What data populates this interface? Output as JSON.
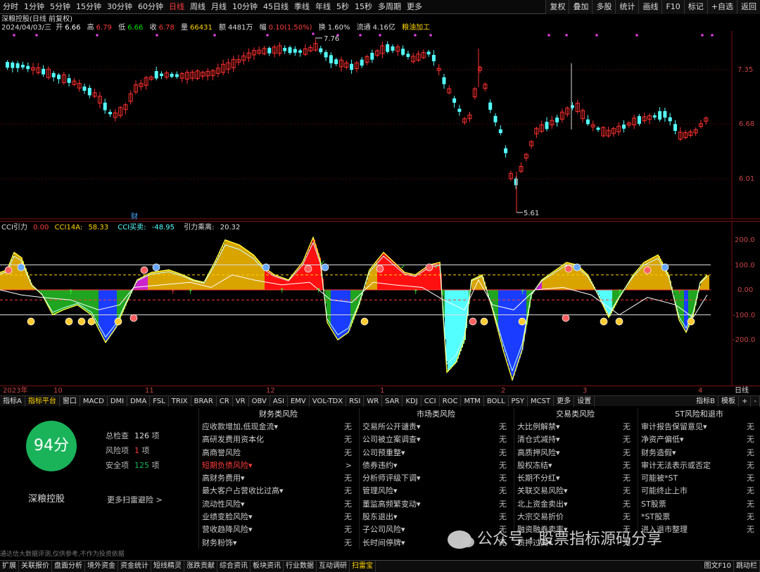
{
  "period_bar": {
    "tabs": [
      "分时",
      "1分钟",
      "5分钟",
      "15分钟",
      "30分钟",
      "60分钟",
      "日线",
      "周线",
      "月线",
      "10分钟",
      "45日线",
      "季线",
      "年线",
      "5秒",
      "15秒",
      "多周期",
      "更多"
    ],
    "active": "日线",
    "right_buttons": [
      "复权",
      "叠加",
      "多股",
      "统计",
      "画线",
      "F10",
      "标记",
      "+自选",
      "返回"
    ]
  },
  "info": {
    "title": "深粮控股(日线 前复权)",
    "date": "2024/04/03/三",
    "open_label": "开",
    "open": "6.66",
    "high_label": "高",
    "high": "6.79",
    "low_label": "低",
    "low": "6.66",
    "close_label": "收",
    "close": "6.78",
    "volume_label": "量",
    "volume": "66431",
    "amount_label": "额",
    "amount": "4481万",
    "change_label": "幅",
    "change": "0.10(1.50%)",
    "turnover_label": "换",
    "turnover": "1.60%",
    "float_label": "流通",
    "float": "4.16亿",
    "industry": "粮油加工",
    "finance_marker": "财"
  },
  "price_chart": {
    "y_labels": [
      "7.35",
      "6.68",
      "6.01"
    ],
    "high_annotation": "7.76",
    "low_annotation": "5.61",
    "colors": {
      "up": "#ff3030",
      "down": "#54ffff",
      "grid": "#7a1010"
    }
  },
  "cci": {
    "name": "CCI引力",
    "v0": "0.00",
    "cci14a_label": "CCI14A:",
    "cci14a": "58.33",
    "cci_deal_label": "CCI买卖:",
    "cci_deal": "-48.95",
    "gravity_label": "引力乘离:",
    "gravity": "20.32",
    "y_labels": [
      "200.0",
      "100.0",
      "0.00",
      "-100.0",
      "-200.0"
    ]
  },
  "time_axis": [
    "2023年",
    "10",
    "11",
    "12",
    "1",
    "2",
    "3",
    "4"
  ],
  "time_axis_right": "日线",
  "indicator_tabs": [
    "指标A",
    "指标平台",
    "窗口",
    "MACD",
    "DMI",
    "DMA",
    "FSL",
    "TRIX",
    "BRAR",
    "CR",
    "VR",
    "OBV",
    "ASI",
    "EMV",
    "VOL-TDX",
    "RSI",
    "WR",
    "SAR",
    "KDJ",
    "CCI",
    "ROC",
    "MTM",
    "BOLL",
    "PSY",
    "MCST",
    "更多",
    "设置"
  ],
  "indicator_active": "指标平台",
  "indicator_right": [
    "指标B",
    "模板",
    "+",
    "-"
  ],
  "scan": {
    "score": "94分",
    "stock_name": "深粮控股",
    "total_label": "总检查",
    "total": "126",
    "total_unit": "项",
    "risk_label": "风险项",
    "risk": "1",
    "risk_unit": "项",
    "safe_label": "安全项",
    "safe": "125",
    "safe_unit": "项",
    "more_link": "更多扫雷避险 >",
    "disclaimer": "通达信大数据评测,仅供参考,不作为投资依据",
    "columns": [
      {
        "title": "财务类风险",
        "rows": [
          {
            "name": "应收款增加,低现金流▾",
            "val": "无"
          },
          {
            "name": "高研发费用资本化",
            "val": "无"
          },
          {
            "name": "高商誉风险",
            "val": "无"
          },
          {
            "name": "短期负债风险▾",
            "val": ">",
            "risk": true
          },
          {
            "name": "高财务费用▾",
            "val": "无"
          },
          {
            "name": "最大客户占营收比过高▾",
            "val": "无"
          },
          {
            "name": "流动性风险▾",
            "val": "无"
          },
          {
            "name": "业绩变脸风险▾",
            "val": "无"
          },
          {
            "name": "营收趋降风险▾",
            "val": "无"
          },
          {
            "name": "财务粉饰▾",
            "val": "无"
          }
        ]
      },
      {
        "title": "市场类风险",
        "rows": [
          {
            "name": "交易所公开谴责▾",
            "val": "无"
          },
          {
            "name": "公司被立案调查▾",
            "val": "无"
          },
          {
            "name": "公司预重整▾",
            "val": "无"
          },
          {
            "name": "债券违约▾",
            "val": "无"
          },
          {
            "name": "分析师评级下调▾",
            "val": "无"
          },
          {
            "name": "管理风险▾",
            "val": "无"
          },
          {
            "name": "董监高频繁变动▾",
            "val": "无"
          },
          {
            "name": "股东退出▾",
            "val": "无"
          },
          {
            "name": "子公司风险▾",
            "val": "无"
          },
          {
            "name": "长时间停牌▾",
            "val": "无"
          }
        ]
      },
      {
        "title": "交易类风险",
        "rows": [
          {
            "name": "大比例解禁▾",
            "val": "无"
          },
          {
            "name": "清仓式减持▾",
            "val": "无"
          },
          {
            "name": "高质押风险▾",
            "val": "无"
          },
          {
            "name": "股权冻结▾",
            "val": "无"
          },
          {
            "name": "长期不分红▾",
            "val": "无"
          },
          {
            "name": "关联交易风险▾",
            "val": "无"
          },
          {
            "name": "北上资金卖出▾",
            "val": "无"
          },
          {
            "name": "大宗交易折价",
            "val": "无"
          },
          {
            "name": "融资融券卖率▾",
            "val": "无"
          },
          {
            "name": "质押过高▾",
            "val": "无"
          }
        ]
      },
      {
        "title": "ST风险和退市",
        "rows": [
          {
            "name": "审计报告保留意见▾",
            "val": "无"
          },
          {
            "name": "净资产偏低▾",
            "val": "无"
          },
          {
            "name": "财务造假▾",
            "val": "无"
          },
          {
            "name": "审计无法表示或否定",
            "val": "无"
          },
          {
            "name": "可能被*ST",
            "val": "无"
          },
          {
            "name": "可能终止上市",
            "val": "无"
          },
          {
            "name": "ST股票",
            "val": "无"
          },
          {
            "name": "*ST股票",
            "val": "无"
          },
          {
            "name": "进入退市整理",
            "val": "无"
          }
        ]
      }
    ],
    "watermark": "公众号 · 股票指标源码分享"
  },
  "bottom_tabs": [
    "扩展",
    "关联报价",
    "盘面分析",
    "境外资金",
    "资金统计",
    "短线精灵",
    "涨跌贡献",
    "综合资讯",
    "板块资讯",
    "行业数据",
    "互动调研",
    "扫雷宝"
  ],
  "bottom_active": "扫雷宝",
  "bottom_right": [
    "图文F10",
    "跳动栏"
  ]
}
